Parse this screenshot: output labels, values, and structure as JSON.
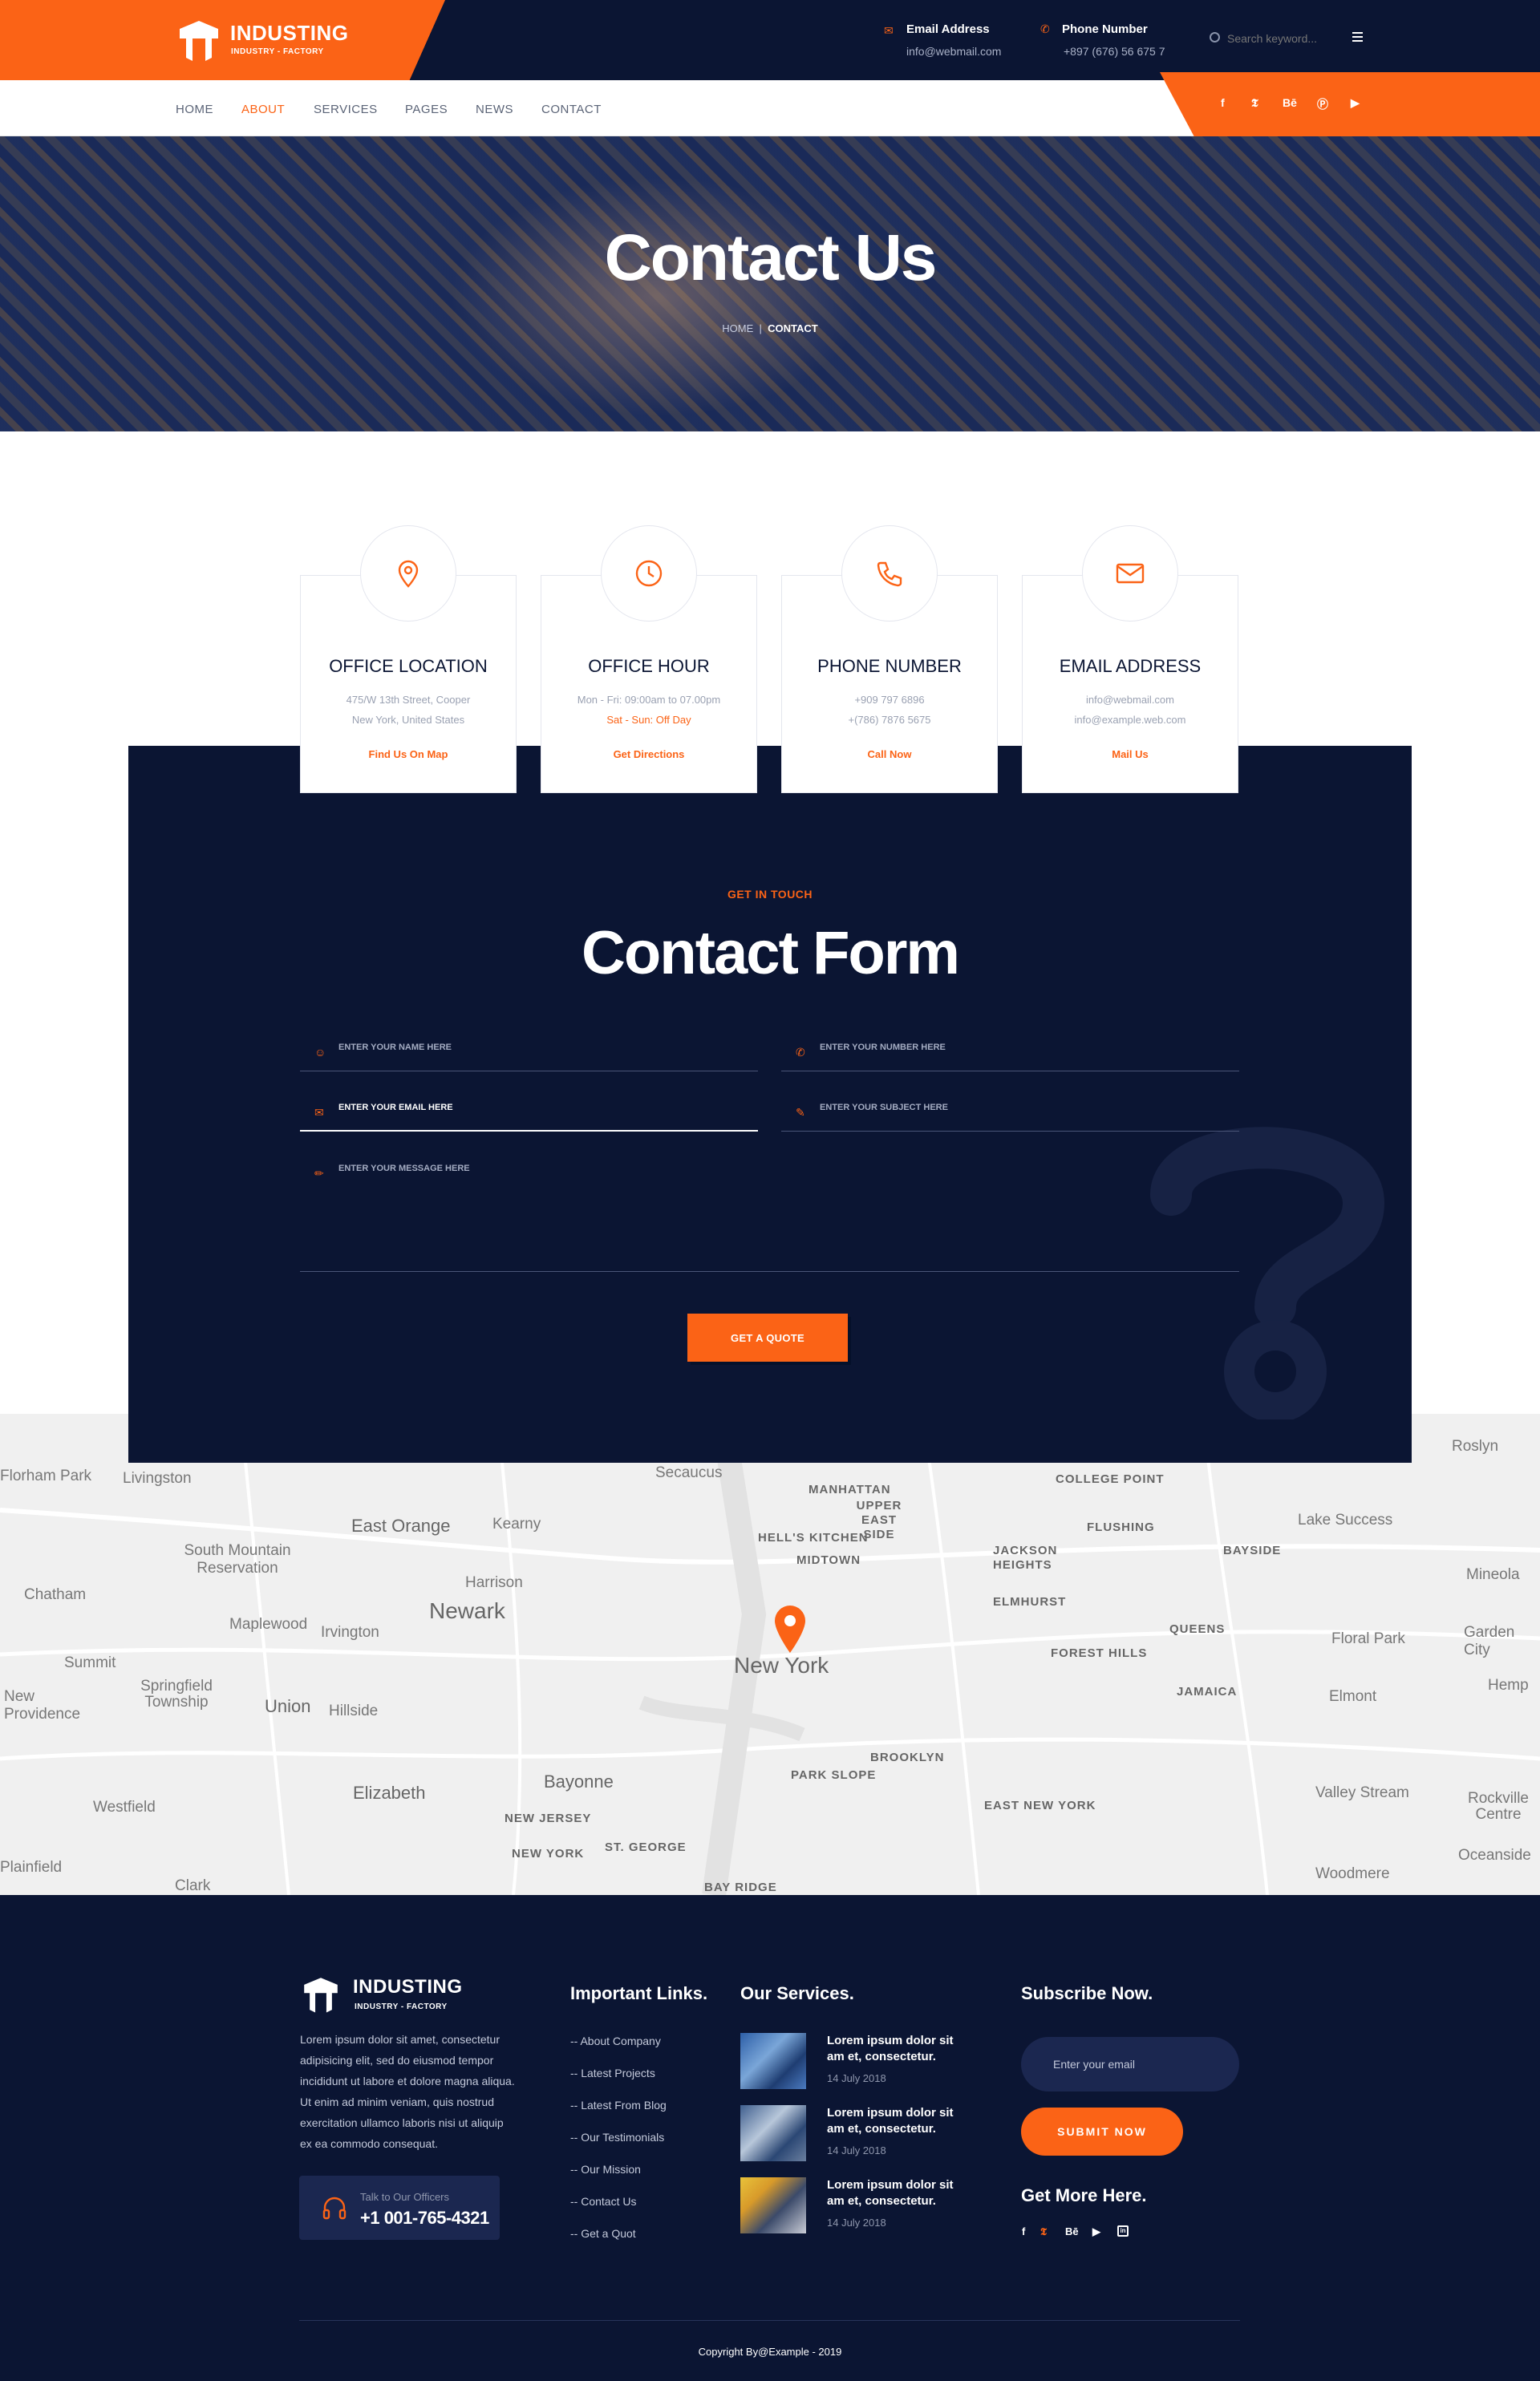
{
  "brand": {
    "name": "INDUSTING",
    "tagline": "INDUSTRY - FACTORY"
  },
  "header": {
    "email_label": "Email Address",
    "email_value": "info@webmail.com",
    "phone_label": "Phone Number",
    "phone_value": "+897 (676) 56 675 7",
    "search_placeholder": "Search keyword..."
  },
  "nav": {
    "items": [
      "HOME",
      "ABOUT",
      "SERVICES",
      "PAGES",
      "NEWS",
      "CONTACT"
    ],
    "active": "ABOUT"
  },
  "social": [
    "f",
    "t",
    "Bē",
    "p",
    "yt"
  ],
  "hero": {
    "title": "Contact Us",
    "crumb_home": "HOME",
    "crumb_current": "CONTACT"
  },
  "cards": [
    {
      "title": "OFFICE LOCATION",
      "line1": "475/W 13th Street, Cooper",
      "line2": "New York, United States",
      "link": "Find Us On Map",
      "icon": "map-pin-icon"
    },
    {
      "title": "OFFICE HOUR",
      "line1": "Mon - Fri: 09:00am to 07.00pm",
      "line2": "Sat - Sun: Off Day",
      "link": "Get Directions",
      "icon": "clock-icon"
    },
    {
      "title": "PHONE NUMBER",
      "line1": "+909 797 6896",
      "line2": "+(786) 7876 5675",
      "link": "Call Now",
      "icon": "phone-icon"
    },
    {
      "title": "EMAIL ADDRESS",
      "line1": "info@webmail.com",
      "line2": "info@example.web.com",
      "link": "Mail Us",
      "icon": "envelope-icon"
    }
  ],
  "form": {
    "eyebrow": "GET IN TOUCH",
    "title": "Contact Form",
    "name_placeholder": "ENTER YOUR NAME HERE",
    "number_placeholder": "ENTER YOUR NUMBER HERE",
    "email_placeholder": "ENTER YOUR EMAIL HERE",
    "subject_placeholder": "ENTER YOUR SUBJECT HERE",
    "message_placeholder": "ENTER YOUR MESSAGE HERE",
    "submit_label": "GET A QUOTE"
  },
  "map": {
    "labels": [
      "Florham Park",
      "Livingston",
      "Secaucus",
      "MANHATTAN",
      "COLLEGE POINT",
      "Roslyn",
      "East Orange",
      "Kearny",
      "UPPER EAST SIDE",
      "FLUSHING",
      "Lake Success",
      "South Mountain Reservation",
      "HELL'S KITCHEN",
      "MIDTOWN",
      "JACKSON HEIGHTS",
      "BAYSIDE",
      "Chatham",
      "Harrison",
      "Newark",
      "ELMHURST",
      "Mineola",
      "Maplewood",
      "Irvington",
      "QUEENS",
      "Floral Park",
      "Summit",
      "New York",
      "FOREST HILLS",
      "Garden City",
      "Springfield Township",
      "Union",
      "Hillside",
      "JAMAICA",
      "Elmont",
      "BROOKLYN",
      "PARK SLOPE",
      "Bayonne",
      "Elizabeth",
      "Westfield",
      "NEW JERSEY",
      "EAST NEW YORK",
      "Valley Stream",
      "Rockville Centre",
      "NEW YORK",
      "ST. GEORGE",
      "Oceanside",
      "Clark",
      "BAY RIDGE",
      "Woodmere",
      "Hemp",
      "New Providence",
      "Plainfield"
    ]
  },
  "footer": {
    "about": "Lorem ipsum dolor sit amet, consectetur adipisicing elit, sed do eiusmod tempor incididunt ut labore et dolore magna aliqua. Ut enim ad minim veniam, quis nostrud exercitation ullamco laboris nisi ut aliquip ex ea commodo consequat.",
    "call_label": "Talk to Our Officers",
    "call_number": "+1 001-765-4321",
    "links_title": "Important Links.",
    "links": [
      "About Company",
      "Latest Projects",
      "Latest From Blog",
      "Our Testimonials",
      "Our Mission",
      "Contact Us",
      "Get a Quot"
    ],
    "services_title": "Our Services.",
    "services": [
      {
        "title": "Lorem ipsum dolor sit am et, consectetur.",
        "date": "14 July 2018"
      },
      {
        "title": "Lorem ipsum dolor sit am et, consectetur.",
        "date": "14 July 2018"
      },
      {
        "title": "Lorem ipsum dolor sit am et, consectetur.",
        "date": "14 July 2018"
      }
    ],
    "subscribe_title": "Subscribe Now.",
    "subscribe_placeholder": "Enter your email",
    "subscribe_button": "SUBMIT NOW",
    "more_title": "Get More Here.",
    "social": [
      "f",
      "t",
      "Bē",
      "yt",
      "in"
    ],
    "copyright": "Copyright By@Example - 2019"
  },
  "colors": {
    "accent": "#fb6316",
    "navy": "#0b1533"
  }
}
